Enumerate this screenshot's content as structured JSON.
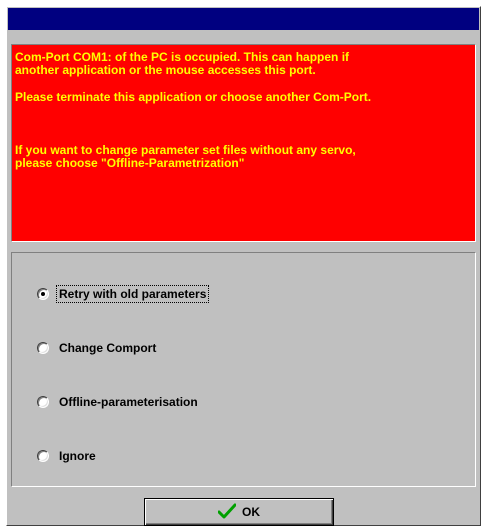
{
  "message": {
    "line1": "Com-Port COM1: of the PC is occupied. This can happen if\nanother application or the mouse accesses this port.",
    "line2": "Please terminate this application or choose another Com-Port.",
    "line3": "If you want to change parameter set files without any servo,\nplease choose \"Offline-Parametrization\""
  },
  "options": [
    {
      "label": "Retry with old parameters",
      "selected": true
    },
    {
      "label": "Change Comport",
      "selected": false
    },
    {
      "label": "Offline-parameterisation",
      "selected": false
    },
    {
      "label": "Ignore",
      "selected": false
    }
  ],
  "ok_button": {
    "label": "OK",
    "icon": "checkmark-icon"
  },
  "colors": {
    "titlebar": "#000080",
    "message_background": "#ff0000",
    "message_text": "#ffff00",
    "dialog_background": "#c0c0c0",
    "checkmark": "#00a000"
  }
}
